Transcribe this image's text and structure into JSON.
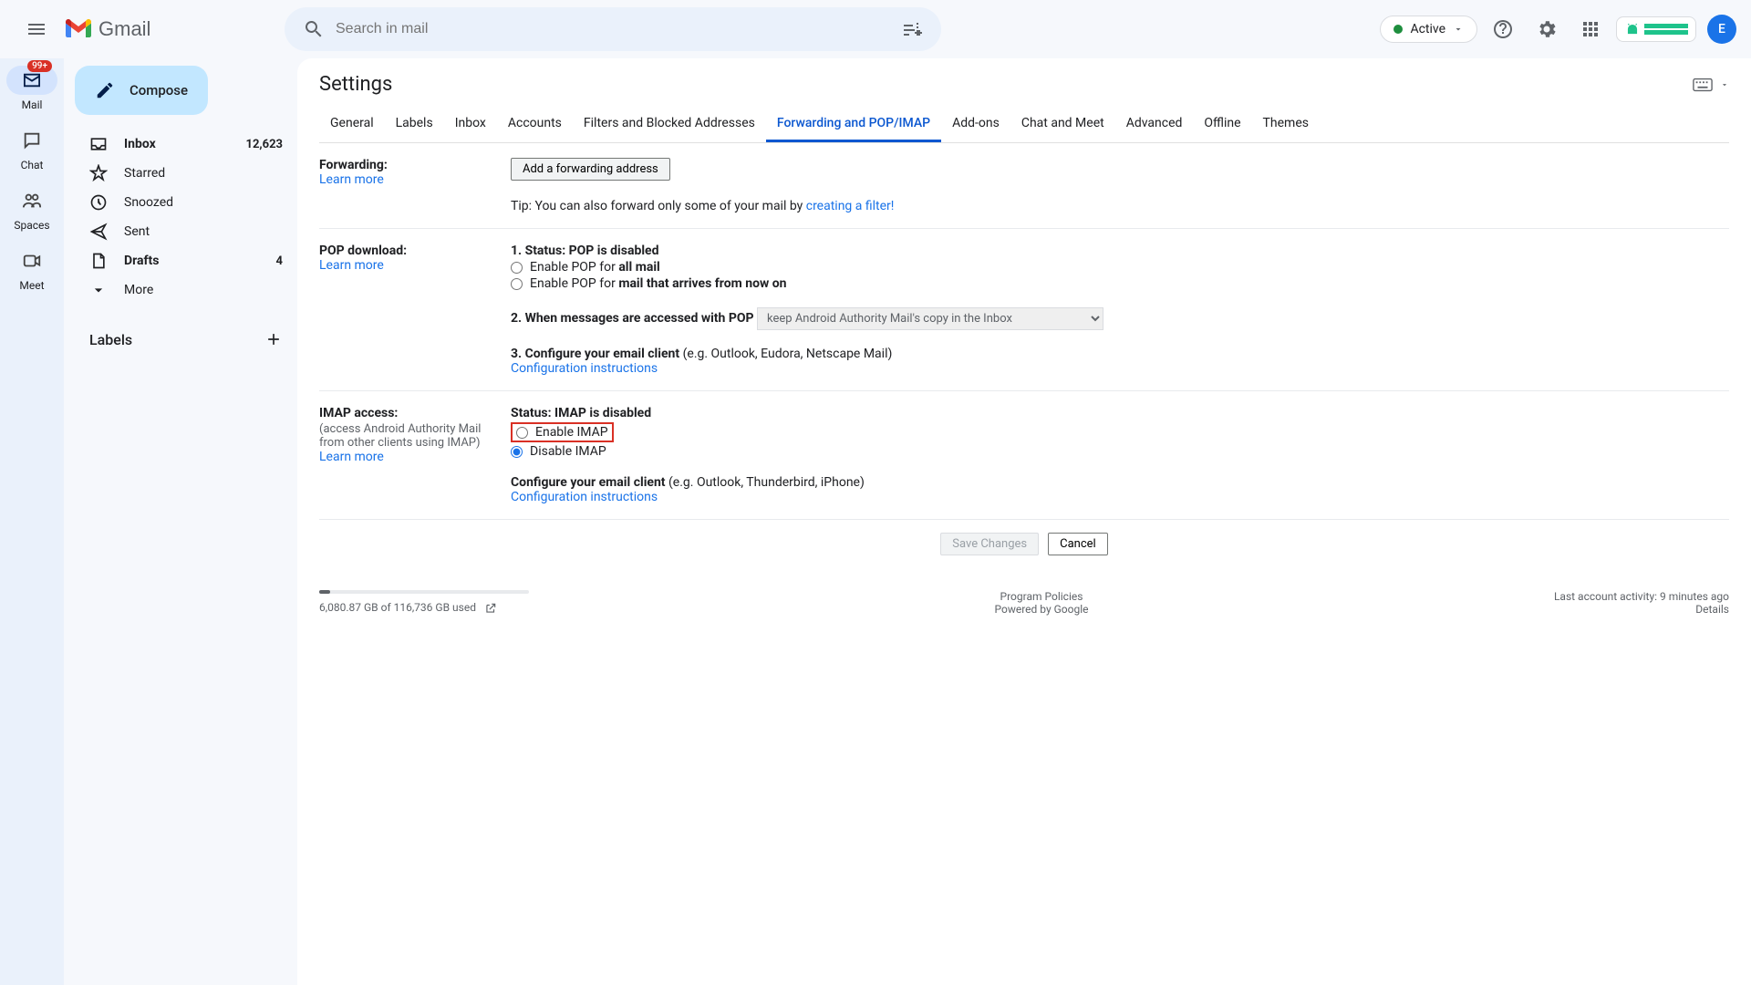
{
  "header": {
    "app_name": "Gmail",
    "search_placeholder": "Search in mail",
    "active_label": "Active",
    "avatar_initial": "E"
  },
  "rail": {
    "mail": "Mail",
    "mail_badge": "99+",
    "chat": "Chat",
    "spaces": "Spaces",
    "meet": "Meet"
  },
  "sidebar": {
    "compose": "Compose",
    "items": [
      {
        "label": "Inbox",
        "count": "12,623"
      },
      {
        "label": "Starred",
        "count": ""
      },
      {
        "label": "Snoozed",
        "count": ""
      },
      {
        "label": "Sent",
        "count": ""
      },
      {
        "label": "Drafts",
        "count": "4"
      },
      {
        "label": "More",
        "count": ""
      }
    ],
    "labels_header": "Labels"
  },
  "settings": {
    "title": "Settings",
    "tabs": [
      "General",
      "Labels",
      "Inbox",
      "Accounts",
      "Filters and Blocked Addresses",
      "Forwarding and POP/IMAP",
      "Add-ons",
      "Chat and Meet",
      "Advanced",
      "Offline",
      "Themes"
    ],
    "active_tab_index": 5,
    "forwarding": {
      "label": "Forwarding:",
      "learn_more": "Learn more",
      "add_button": "Add a forwarding address",
      "tip_prefix": "Tip: You can also forward only some of your mail by ",
      "tip_link": "creating a filter!"
    },
    "pop": {
      "label": "POP download:",
      "learn_more": "Learn more",
      "status_prefix": "1. Status: ",
      "status_bold": "POP is disabled",
      "opt1_prefix": "Enable POP for ",
      "opt1_bold": "all mail",
      "opt2_prefix": "Enable POP for ",
      "opt2_bold": "mail that arrives from now on",
      "step2": "2. When messages are accessed with POP",
      "select_value": "keep Android Authority Mail's copy in the Inbox",
      "step3_bold": "3. Configure your email client",
      "step3_rest": " (e.g. Outlook, Eudora, Netscape Mail)",
      "config_link": "Configuration instructions"
    },
    "imap": {
      "label": "IMAP access:",
      "hint": "(access Android Authority Mail from other clients using IMAP)",
      "learn_more": "Learn more",
      "status_prefix": "Status: ",
      "status_bold": "IMAP is disabled",
      "enable": "Enable IMAP",
      "disable": "Disable IMAP",
      "config_bold": "Configure your email client",
      "config_rest": " (e.g. Outlook, Thunderbird, iPhone)",
      "config_link": "Configuration instructions"
    },
    "save": "Save Changes",
    "cancel": "Cancel"
  },
  "footer": {
    "storage": "6,080.87 GB of 116,736 GB used",
    "policies": "Program Policies",
    "powered": "Powered by Google",
    "activity": "Last account activity: 9 minutes ago",
    "details": "Details"
  }
}
